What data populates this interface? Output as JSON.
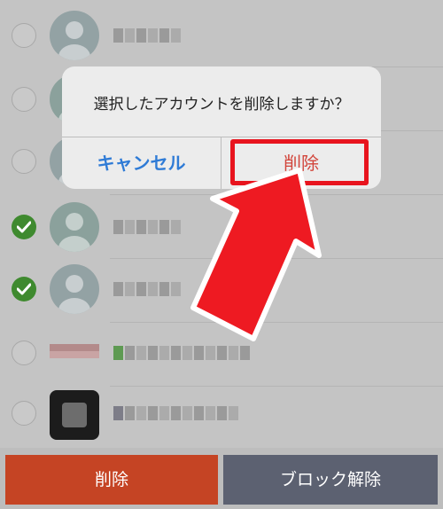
{
  "dialog": {
    "message": "選択したアカウントを削除しますか？",
    "cancel_label": "キャンセル",
    "confirm_label": "削除"
  },
  "contacts": [
    {
      "selected": false
    },
    {
      "selected": false
    },
    {
      "selected": false
    },
    {
      "selected": true
    },
    {
      "selected": true
    },
    {
      "selected": false
    },
    {
      "selected": false
    }
  ],
  "bottom_bar": {
    "delete_label": "削除",
    "unblock_label": "ブロック解除"
  },
  "colors": {
    "highlight": "#e8141e",
    "delete_button": "#c54424",
    "unblock_button": "#5c6171",
    "checked": "#3f8a2f",
    "cancel_text": "#2f7bd6",
    "confirm_text": "#d2443a"
  }
}
